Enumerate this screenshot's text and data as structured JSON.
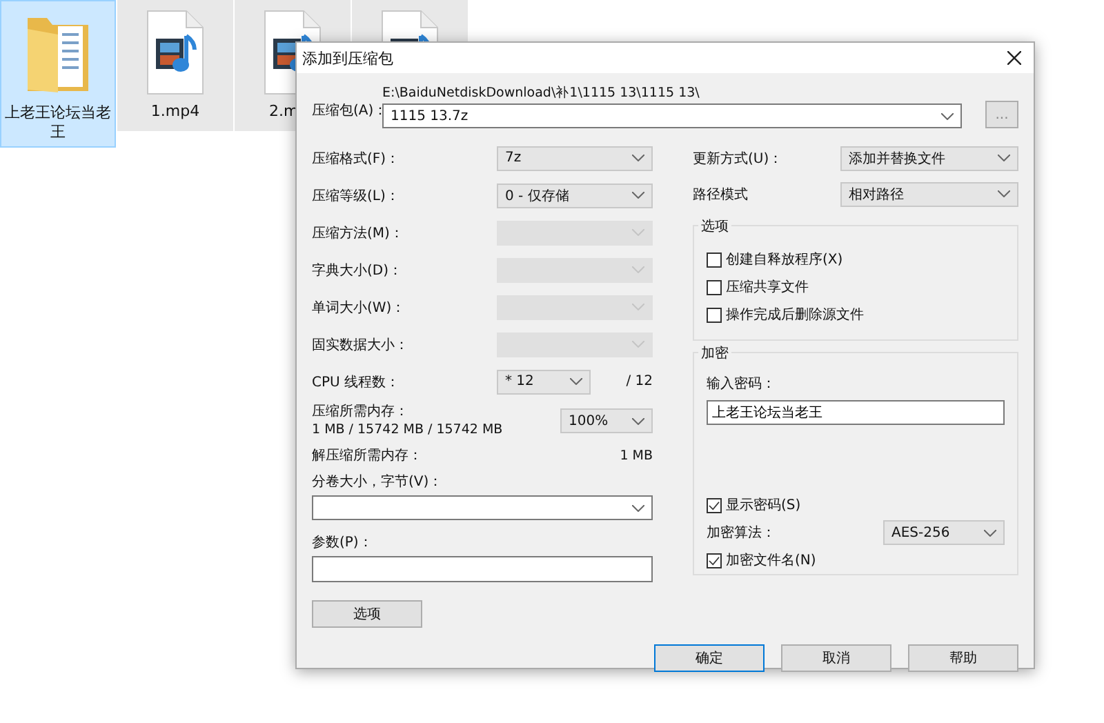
{
  "desktop": {
    "files": [
      {
        "kind": "folder",
        "name": "上老王论坛当老王",
        "selected": true
      },
      {
        "kind": "video",
        "name": "1.mp4",
        "selected": false
      },
      {
        "kind": "video",
        "name": "2.m",
        "selected": false
      },
      {
        "kind": "video",
        "selected": false
      }
    ]
  },
  "dialog": {
    "title": "添加到压缩包",
    "archive": {
      "label": "压缩包(A)：",
      "path": "E:\\BaiduNetdiskDownload\\补1\\1115 13\\1115 13\\",
      "value": "1115 13.7z",
      "browse": "..."
    },
    "settings": [
      {
        "kind": "select",
        "label": "压缩格式(F)：",
        "value": "7z",
        "disabled": false
      },
      {
        "kind": "select",
        "label": "压缩等级(L)：",
        "value": "0 - 仅存储",
        "disabled": false
      },
      {
        "kind": "select",
        "label": "压缩方法(M)：",
        "disabled": true
      },
      {
        "kind": "select",
        "label": "字典大小(D)：",
        "disabled": true
      },
      {
        "kind": "select",
        "label": "单词大小(W)：",
        "disabled": true
      },
      {
        "kind": "select",
        "label": "固实数据大小：",
        "disabled": true
      }
    ],
    "threads": {
      "label": "CPU 线程数：",
      "value": "* 12",
      "total": "/ 12"
    },
    "memory": {
      "label": "压缩所需内存：",
      "detail": "1 MB / 15742 MB / 15742 MB",
      "value": "100%"
    },
    "decompress": {
      "label": "解压缩所需内存：",
      "value": "1 MB"
    },
    "volume": {
      "label": "分卷大小，字节(V)："
    },
    "params": {
      "label": "参数(P)："
    },
    "options_button": "选项",
    "update": {
      "label": "更新方式(U)：",
      "value": "添加并替换文件"
    },
    "path_mode": {
      "label": "路径模式",
      "value": "相对路径"
    },
    "options": {
      "title": "选项",
      "checkboxes": [
        {
          "label": "创建自释放程序(X)",
          "checked": false
        },
        {
          "label": "压缩共享文件",
          "checked": false
        },
        {
          "label": "操作完成后删除源文件",
          "checked": false
        }
      ]
    },
    "encryption": {
      "title": "加密",
      "password_label": "输入密码：",
      "password": "上老王论坛当老王",
      "show_password": {
        "label": "显示密码(S)",
        "checked": true
      },
      "method": {
        "label": "加密算法：",
        "value": "AES-256"
      },
      "encrypt_names": {
        "label": "加密文件名(N)",
        "checked": true
      }
    },
    "buttons": [
      {
        "label": "确定",
        "default": true
      },
      {
        "label": "取消",
        "default": false
      },
      {
        "label": "帮助",
        "default": false
      }
    ]
  }
}
